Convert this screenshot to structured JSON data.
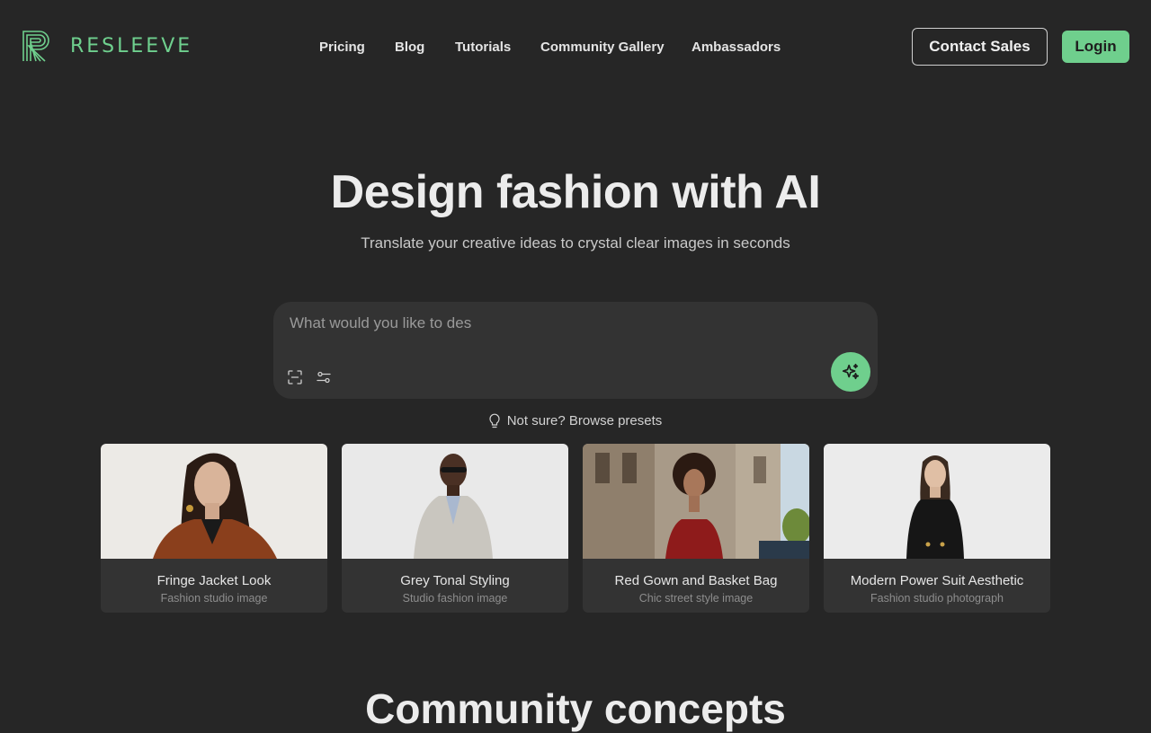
{
  "brand": {
    "name": "RESLEEVE",
    "accent": "#6fcf8d"
  },
  "nav": {
    "items": [
      {
        "label": "Pricing"
      },
      {
        "label": "Blog"
      },
      {
        "label": "Tutorials"
      },
      {
        "label": "Community Gallery"
      },
      {
        "label": "Ambassadors"
      }
    ],
    "contact_label": "Contact Sales",
    "login_label": "Login"
  },
  "hero": {
    "title": "Design fashion with AI",
    "subtitle": "Translate your creative ideas to crystal clear images in seconds"
  },
  "prompt": {
    "placeholder": "What would you like to des",
    "icons": [
      "scan-icon",
      "sliders-icon",
      "sparkles-icon"
    ]
  },
  "presets": {
    "label": "Not sure? Browse presets",
    "icon": "lightbulb-icon"
  },
  "cards": [
    {
      "title": "Fringe Jacket Look",
      "subtitle": "Fashion studio image"
    },
    {
      "title": "Grey Tonal Styling",
      "subtitle": "Studio fashion image"
    },
    {
      "title": "Red Gown and Basket Bag",
      "subtitle": "Chic street style image"
    },
    {
      "title": "Modern Power Suit Aesthetic",
      "subtitle": "Fashion studio photograph"
    }
  ],
  "section": {
    "title": "Community concepts"
  },
  "colors": {
    "background": "#262626",
    "surface": "#333333",
    "accent": "#6fcf8d"
  }
}
